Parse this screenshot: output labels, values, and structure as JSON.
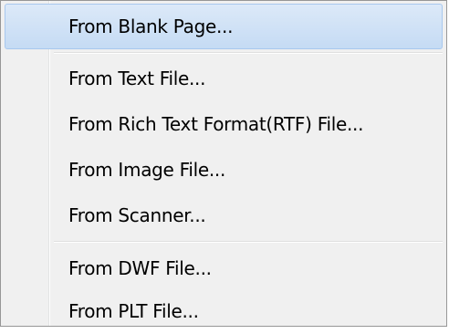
{
  "menu": {
    "items": [
      {
        "label": "From Blank Page..."
      },
      {
        "label": "From Text File..."
      },
      {
        "label": "From Rich Text Format(RTF) File..."
      },
      {
        "label": "From Image File..."
      },
      {
        "label": "From Scanner..."
      },
      {
        "label": "From DWF File..."
      },
      {
        "label": "From PLT File..."
      }
    ],
    "highlight_color": "#c5dbf4"
  }
}
